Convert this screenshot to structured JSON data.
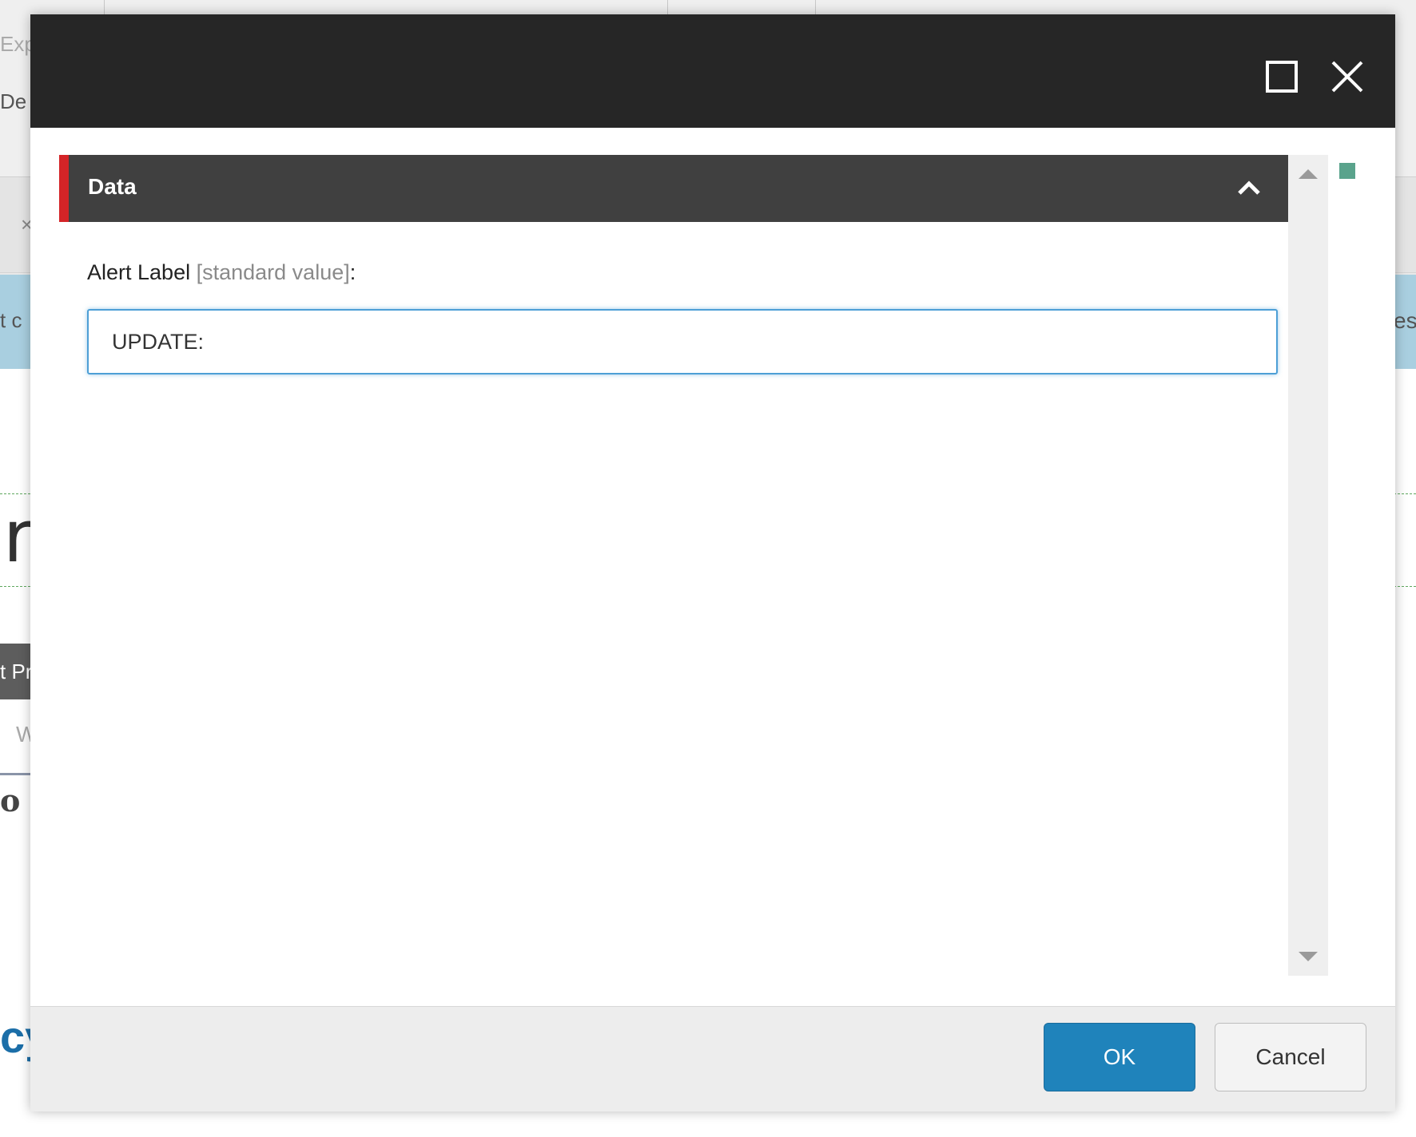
{
  "background": {
    "fragments": [
      "Exp",
      "De",
      "t c",
      "r",
      "t Pr",
      "W",
      "o",
      "cy",
      "es"
    ]
  },
  "dialog": {
    "titlebar": {
      "maximize_icon": "maximize-icon",
      "close_icon": "close-icon"
    },
    "section": {
      "title": "Data",
      "chevron_icon": "chevron-up-icon",
      "accent_color": "#d42427"
    },
    "field": {
      "label": "Alert Label",
      "label_suffix": "[standard value]",
      "label_colon": ":",
      "value": "UPDATE:"
    },
    "footer": {
      "ok_label": "OK",
      "cancel_label": "Cancel"
    }
  },
  "colors": {
    "titlebar": "#262626",
    "section_header": "#404040",
    "primary_button": "#1f83bb",
    "status_marker": "#5aa38c"
  }
}
